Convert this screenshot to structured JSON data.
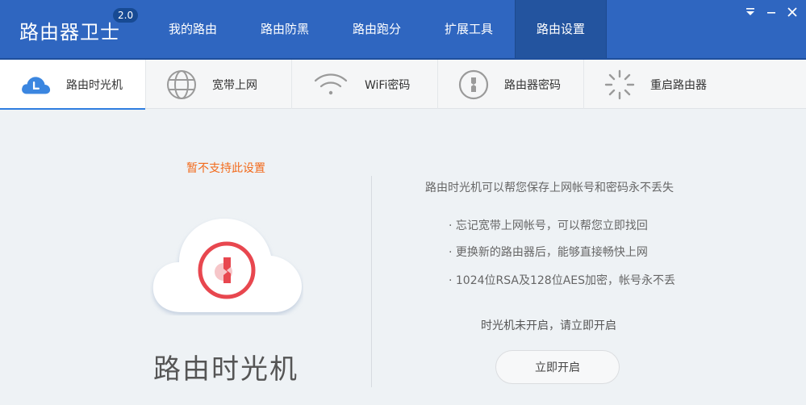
{
  "app": {
    "title": "路由器卫士",
    "version": "2.0"
  },
  "nav": [
    {
      "label": "我的路由"
    },
    {
      "label": "路由防黑"
    },
    {
      "label": "路由跑分"
    },
    {
      "label": "扩展工具"
    },
    {
      "label": "路由设置",
      "active": true
    }
  ],
  "window": {
    "menu_glyph": "⏷",
    "minimize_glyph": "—",
    "close_glyph": "✕"
  },
  "tabs": [
    {
      "label": "路由时光机",
      "icon": "cloud-clock-icon",
      "active": true
    },
    {
      "label": "宽带上网",
      "icon": "globe-icon"
    },
    {
      "label": "WiFi密码",
      "icon": "wifi-icon"
    },
    {
      "label": "路由器密码",
      "icon": "key-circle-icon"
    },
    {
      "label": "重启路由器",
      "icon": "restart-spinner-icon"
    }
  ],
  "main": {
    "warning": "暂不支持此设置",
    "feature_title": "路由时光机",
    "description_title": "路由时光机可以帮您保存上网帐号和密码永不丢失",
    "bullets": [
      "· 忘记宽带上网帐号，可以帮您立即找回",
      "· 更换新的路由器后，能够直接畅快上网",
      "· 1024位RSA及128位AES加密，帐号永不丢"
    ],
    "status": "时光机未开启，请立即开启",
    "enable_button": "立即开启"
  },
  "colors": {
    "top_bar": "#2f66c0",
    "accent_blue": "#2f7de0",
    "warning_orange": "#f26a1b",
    "key_red": "#e8474f"
  }
}
